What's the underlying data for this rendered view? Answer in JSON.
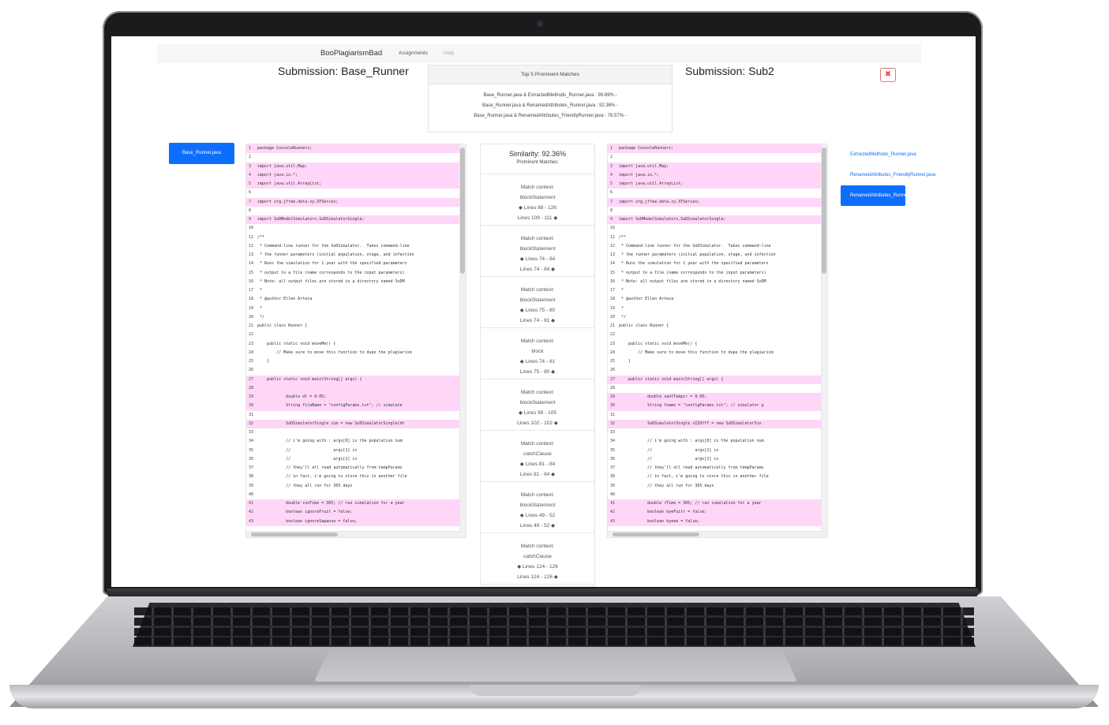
{
  "navbar": {
    "brand": "BooPlagiarismBad",
    "links": [
      "Assignments",
      "Help"
    ]
  },
  "left_submission": {
    "title": "Submission: Base_Runner",
    "file_button": "Base_Runner.java"
  },
  "right_submission": {
    "title": "Submission: Sub2",
    "files": [
      "ExtractedMethods_Runner.java",
      "RenamedAttributes_FriendlyRunner.java",
      "RenamedAttributes_Runner.java"
    ]
  },
  "top_matches": {
    "header": "Top 5 Prominent Matches",
    "rows": [
      "Base_Runner.java & ExtractedMethods_Runner.java : 99.89% -",
      "Base_Runner.java & RenamedAttributes_Runner.java : 92.36% -",
      "Base_Runner.java & RenamedAttributes_FriendlyRunner.java : 76.57% -"
    ]
  },
  "close_icon": "x-icon",
  "colors": {
    "accent": "#0d6efd",
    "highlight": "#ffd6f8",
    "danger": "#d9534f"
  },
  "similarity": {
    "title": "Similarity: 92.36%",
    "subtitle": "Prominent Matches:"
  },
  "matches": [
    {
      "label": "Match context:",
      "context": "blockStatement",
      "left": "◆ Lines 88 - 126",
      "right": "Lines 109 - 111 ◆"
    },
    {
      "label": "Match context:",
      "context": "blockStatement",
      "left": "◆ Lines 74 - 84",
      "right": "Lines 74 - 84 ◆"
    },
    {
      "label": "Match context:",
      "context": "blockStatement",
      "left": "◆ Lines 75 - 80",
      "right": "Lines 74 - 81 ◆"
    },
    {
      "label": "Match context:",
      "context": "block",
      "left": "◆ Lines 74 - 81",
      "right": "Lines 75 - 80 ◆"
    },
    {
      "label": "Match context:",
      "context": "blockStatement",
      "left": "◆ Lines 99 - 105",
      "right": "Lines 102 - 102 ◆"
    },
    {
      "label": "Match context:",
      "context": "catchClause",
      "left": "◆ Lines 81 - 84",
      "right": "Lines 81 - 84 ◆"
    },
    {
      "label": "Match context:",
      "context": "blockStatement",
      "left": "◆ Lines 49 - 52",
      "right": "Lines 49 - 52 ◆"
    },
    {
      "label": "Match context:",
      "context": "catchClause",
      "left": "◆ Lines 124 - 126",
      "right": "Lines 124 - 126 ◆"
    }
  ],
  "left_code": [
    {
      "n": "1",
      "t": "package ConsoleRunners;",
      "hl": true
    },
    {
      "n": "2",
      "t": "",
      "hl": false
    },
    {
      "n": "3",
      "t": "import java.util.Map;",
      "hl": true
    },
    {
      "n": "4",
      "t": "import java.io.*;",
      "hl": true
    },
    {
      "n": "5",
      "t": "import java.util.ArrayList;",
      "hl": true
    },
    {
      "n": "6",
      "t": "",
      "hl": false
    },
    {
      "n": "7",
      "t": "import org.jfree.data.xy.XYSeries;",
      "hl": true
    },
    {
      "n": "8",
      "t": "",
      "hl": false
    },
    {
      "n": "9",
      "t": "import SoDModelSimulators.SoDSimulatorSingle;",
      "hl": true
    },
    {
      "n": "10",
      "t": "",
      "hl": false
    },
    {
      "n": "11",
      "t": "/**",
      "hl": false
    },
    {
      "n": "12",
      "t": " * Command-line runner for the SoDSimulator.  Takes command-line",
      "hl": false
    },
    {
      "n": "13",
      "t": " * the runner parameters (initial population, stage, and infection",
      "hl": false
    },
    {
      "n": "14",
      "t": " * Runs the simulation for 1 year with the specified parameters",
      "hl": false
    },
    {
      "n": "15",
      "t": " * output to a file (name corresponds to the input parameters)",
      "hl": false
    },
    {
      "n": "16",
      "t": " * Note: all output files are stored in a directory named SoDM",
      "hl": false
    },
    {
      "n": "17",
      "t": " *",
      "hl": false
    },
    {
      "n": "18",
      "t": " * @author Ellen Arteca",
      "hl": false
    },
    {
      "n": "19",
      "t": " *",
      "hl": false
    },
    {
      "n": "20",
      "t": " */",
      "hl": false
    },
    {
      "n": "21",
      "t": "public class Runner {",
      "hl": false
    },
    {
      "n": "22",
      "t": "",
      "hl": false
    },
    {
      "n": "23",
      "t": "    public static void moveMe() {",
      "hl": false
    },
    {
      "n": "24",
      "t": "        // Make sure to move this function to dupe the plagiarism",
      "hl": false
    },
    {
      "n": "25",
      "t": "    }",
      "hl": false
    },
    {
      "n": "26",
      "t": "",
      "hl": false
    },
    {
      "n": "27",
      "t": "    public static void main(String[] args) {",
      "hl": true
    },
    {
      "n": "28",
      "t": "",
      "hl": true
    },
    {
      "n": "29",
      "t": "            double dt = 0.05;",
      "hl": true
    },
    {
      "n": "30",
      "t": "            String fileName = \"configParams.txt\"; // simulate",
      "hl": true
    },
    {
      "n": "31",
      "t": "",
      "hl": false
    },
    {
      "n": "32",
      "t": "            SoDSimulatorSingle sim = new SoDSimulatorSingle(dt",
      "hl": true
    },
    {
      "n": "33",
      "t": "",
      "hl": false
    },
    {
      "n": "34",
      "t": "            // i'm going with : args[0] is the population num",
      "hl": false
    },
    {
      "n": "35",
      "t": "            //                  args[1] is",
      "hl": false
    },
    {
      "n": "36",
      "t": "            //                  args[2] is",
      "hl": false
    },
    {
      "n": "37",
      "t": "            // they'll all read automatically from tempParams",
      "hl": false
    },
    {
      "n": "38",
      "t": "            // in fact, i'm going to store this in another file",
      "hl": false
    },
    {
      "n": "39",
      "t": "            // they all run for 365 days",
      "hl": false
    },
    {
      "n": "40",
      "t": "",
      "hl": false
    },
    {
      "n": "41",
      "t": "            double runTime = 365; // run simulation for a year",
      "hl": true
    },
    {
      "n": "42",
      "t": "            boolean ignoreFruit = false;",
      "hl": true
    },
    {
      "n": "43",
      "t": "            boolean ignoreSapause = false;",
      "hl": true
    }
  ],
  "right_code": [
    {
      "n": "1",
      "t": "package ConsoleRunners;",
      "hl": true
    },
    {
      "n": "2",
      "t": "",
      "hl": false
    },
    {
      "n": "3",
      "t": "import java.util.Map;",
      "hl": true
    },
    {
      "n": "4",
      "t": "import java.io.*;",
      "hl": true
    },
    {
      "n": "5",
      "t": "import java.util.ArrayList;",
      "hl": true
    },
    {
      "n": "6",
      "t": "",
      "hl": false
    },
    {
      "n": "7",
      "t": "import org.jfree.data.xy.XYSeries;",
      "hl": true
    },
    {
      "n": "8",
      "t": "",
      "hl": false
    },
    {
      "n": "9",
      "t": "import SoDModelSimulators.SoDSimulatorSingle;",
      "hl": true
    },
    {
      "n": "10",
      "t": "",
      "hl": false
    },
    {
      "n": "11",
      "t": "/**",
      "hl": false
    },
    {
      "n": "12",
      "t": " * Command-line runner for the SoDSimulator.  Takes command-line",
      "hl": false
    },
    {
      "n": "13",
      "t": " * the runner parameters (initial population, stage, and infection",
      "hl": false
    },
    {
      "n": "14",
      "t": " * Runs the simulation for 1 year with the specified parameters",
      "hl": false
    },
    {
      "n": "15",
      "t": " * output to a file (name corresponds to the input parameters)",
      "hl": false
    },
    {
      "n": "16",
      "t": " * Note: all output files are stored in a directory named SoDM",
      "hl": false
    },
    {
      "n": "17",
      "t": " *",
      "hl": false
    },
    {
      "n": "18",
      "t": " * @author Ellen Arteca",
      "hl": false
    },
    {
      "n": "19",
      "t": " *",
      "hl": false
    },
    {
      "n": "20",
      "t": " */",
      "hl": false
    },
    {
      "n": "21",
      "t": "public class Runner {",
      "hl": false
    },
    {
      "n": "22",
      "t": "",
      "hl": false
    },
    {
      "n": "23",
      "t": "    public static void moveMe() {",
      "hl": false
    },
    {
      "n": "24",
      "t": "        // Make sure to move this function to dupe the plagiarism",
      "hl": false
    },
    {
      "n": "25",
      "t": "    }",
      "hl": false
    },
    {
      "n": "26",
      "t": "",
      "hl": false
    },
    {
      "n": "27",
      "t": "    public static void main(String[] args) {",
      "hl": true
    },
    {
      "n": "28",
      "t": "",
      "hl": false
    },
    {
      "n": "29",
      "t": "            double santTempir = 0.05;",
      "hl": true
    },
    {
      "n": "30",
      "t": "            String fname = \"configParams.txt\"; // simulator p",
      "hl": true
    },
    {
      "n": "31",
      "t": "",
      "hl": false
    },
    {
      "n": "32",
      "t": "            SoDSimulatorSingle sIIDfff = new SoDSimulatorSin",
      "hl": true
    },
    {
      "n": "33",
      "t": "",
      "hl": false
    },
    {
      "n": "34",
      "t": "            // i'm going with : args[0] is the population num",
      "hl": false
    },
    {
      "n": "35",
      "t": "            //                  args[1] is",
      "hl": false
    },
    {
      "n": "36",
      "t": "            //                  args[2] is",
      "hl": false
    },
    {
      "n": "37",
      "t": "            // they'll all read automatically from tempParams",
      "hl": false
    },
    {
      "n": "38",
      "t": "            // in fact, i'm going to store this in another file",
      "hl": false
    },
    {
      "n": "39",
      "t": "            // they all run for 365 days",
      "hl": false
    },
    {
      "n": "40",
      "t": "",
      "hl": false
    },
    {
      "n": "41",
      "t": "            double rTime = 365; // run simulation for a year",
      "hl": true
    },
    {
      "n": "42",
      "t": "            boolean byeFuitr = false;",
      "hl": true
    },
    {
      "n": "43",
      "t": "            boolean byeee = false;",
      "hl": true
    }
  ]
}
